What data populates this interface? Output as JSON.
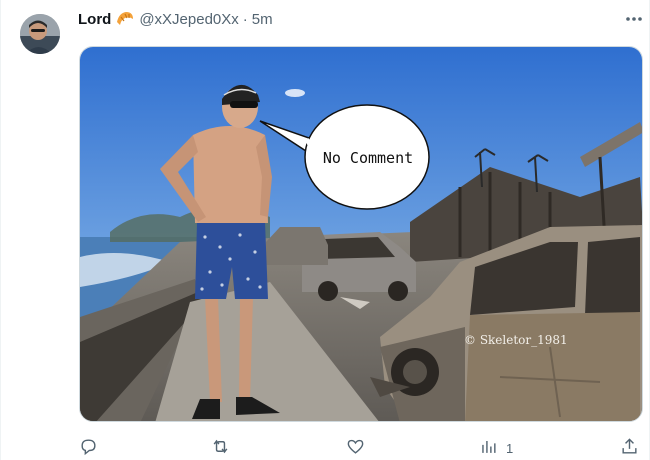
{
  "author": {
    "display_name": "Lord",
    "badge_icon": "croissant-icon",
    "handle": "@xXJeped0Xx",
    "separator": "·",
    "time": "5m"
  },
  "menu": {
    "more_icon": "more-horizontal-icon",
    "more_label": "•••"
  },
  "media": {
    "speech_bubble_text": "No Comment",
    "watermark": "© Skeletor_1981",
    "scene": "photo"
  },
  "actions": {
    "reply_icon": "reply-icon",
    "retweet_icon": "retweet-icon",
    "like_icon": "heart-icon",
    "views_icon": "bar-chart-icon",
    "views_count": "1",
    "share_icon": "share-icon"
  },
  "colors": {
    "primary_text": "#0f1419",
    "secondary_text": "#536471",
    "border": "#cfd9de",
    "badge": "#f4a23a"
  }
}
